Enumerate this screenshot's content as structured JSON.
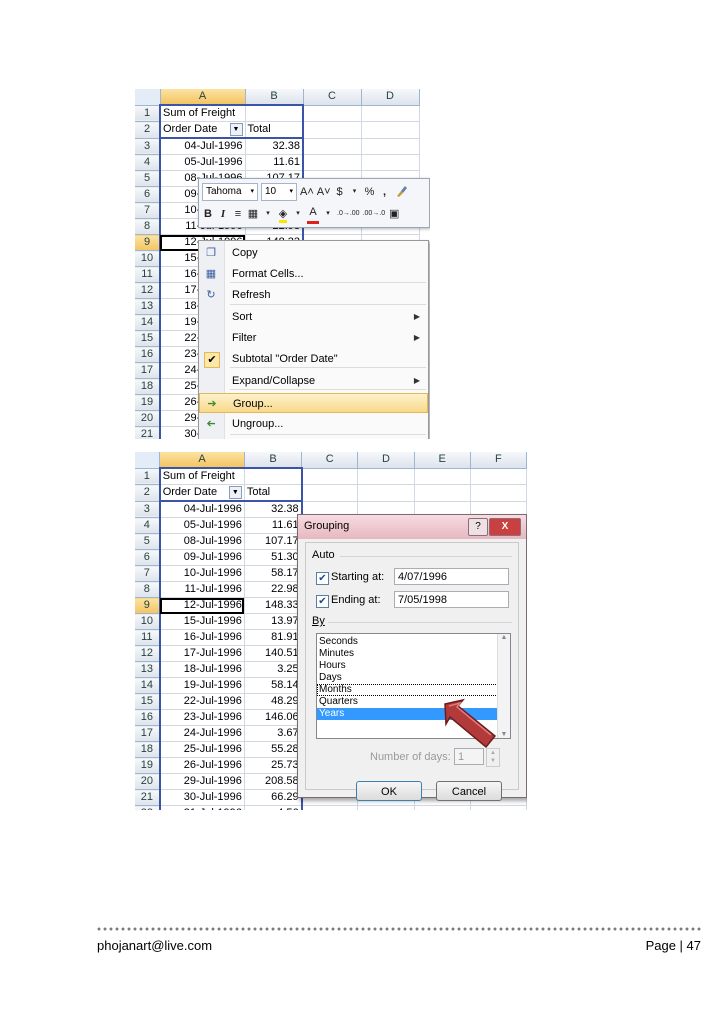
{
  "columns_top": [
    "A",
    "B",
    "C",
    "D"
  ],
  "columns_bottom": [
    "A",
    "B",
    "C",
    "D",
    "E",
    "F"
  ],
  "header": {
    "sum_label": "Sum of Freight",
    "row_label": "Order Date",
    "total_label": "Total"
  },
  "rows": [
    {
      "date": "04-Jul-1996",
      "total": "32.38"
    },
    {
      "date": "05-Jul-1996",
      "total": "11.61"
    },
    {
      "date": "08-Jul-1996",
      "total": "107.17"
    },
    {
      "date": "09-Jul-1996",
      "total": "51.30"
    },
    {
      "date": "10-Jul-1996",
      "total": "58.17"
    },
    {
      "date": "11-Jul-1996",
      "total": "22.98"
    },
    {
      "date": "12-Jul-1996",
      "total": "148.33"
    },
    {
      "date": "15-Jul-1996",
      "total": "13.97"
    },
    {
      "date": "16-Jul-1996",
      "total": "81.91"
    },
    {
      "date": "17-Jul-1996",
      "total": "140.51"
    },
    {
      "date": "18-Jul-1996",
      "total": "3.25"
    },
    {
      "date": "19-Jul-1996",
      "total": "58.14"
    },
    {
      "date": "22-Jul-1996",
      "total": "48.29"
    },
    {
      "date": "23-Jul-1996",
      "total": "146.06"
    },
    {
      "date": "24-Jul-1996",
      "total": "3.67"
    },
    {
      "date": "25-Jul-1996",
      "total": "55.28"
    },
    {
      "date": "26-Jul-1996",
      "total": "25.73"
    },
    {
      "date": "29-Jul-1996",
      "total": "208.58"
    },
    {
      "date": "30-Jul-1996",
      "total": "66.29"
    },
    {
      "date": "31-Jul-1996",
      "total": "4.56"
    }
  ],
  "minibar": {
    "font": "Tahoma",
    "size": "10",
    "grow": "A˄",
    "shrink": "A˅",
    "currency": "$",
    "percent": "%",
    "comma": ",",
    "bold": "B",
    "italic": "I",
    "font_color": "A",
    "inc_dec": ".0→.00",
    "dec_dec": ".00→.0"
  },
  "context_menu": [
    {
      "label": "Copy",
      "icon": "copy-icon",
      "glyph": "❐",
      "submenu": false
    },
    {
      "label": "Format Cells...",
      "icon": "format-cells-icon",
      "glyph": "▦",
      "submenu": false
    },
    {
      "label": "Refresh",
      "icon": "refresh-icon",
      "glyph": "↻",
      "submenu": false
    },
    {
      "label": "Sort",
      "icon": "",
      "glyph": "",
      "submenu": true
    },
    {
      "label": "Filter",
      "icon": "",
      "glyph": "",
      "submenu": true
    },
    {
      "label": "Subtotal \"Order Date\"",
      "icon": "check-icon",
      "glyph": "✔",
      "submenu": false
    },
    {
      "label": "Expand/Collapse",
      "icon": "",
      "glyph": "",
      "submenu": true
    },
    {
      "label": "Group...",
      "icon": "group-arrow-icon",
      "glyph": "➔",
      "submenu": false
    },
    {
      "label": "Ungroup...",
      "icon": "ungroup-arrow-icon",
      "glyph": "➔",
      "submenu": false
    }
  ],
  "dialog": {
    "title": "Grouping",
    "help": "?",
    "close": "X",
    "auto_label": "Auto",
    "starting_label": "Starting at:",
    "starting_value": "4/07/1996",
    "ending_label": "Ending at:",
    "ending_value": "7/05/1998",
    "by_label": "By",
    "by_options": [
      "Seconds",
      "Minutes",
      "Hours",
      "Days",
      "Months",
      "Quarters",
      "Years"
    ],
    "selected_option": "Years",
    "focused_option": "Months",
    "days_label": "Number of days:",
    "days_value": "1",
    "ok": "OK",
    "cancel": "Cancel"
  },
  "footer": {
    "email": "phojanart@live.com",
    "page": "Page | 47"
  }
}
